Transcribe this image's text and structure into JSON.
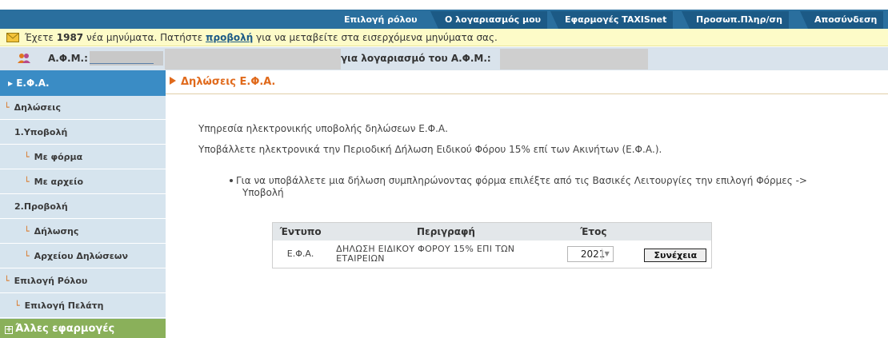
{
  "topnav": {
    "tabs": [
      {
        "label": "Επιλογή ρόλου"
      },
      {
        "label": "Ο λογαριασμός μου"
      },
      {
        "label": "Εφαρμογές TAXISnet"
      },
      {
        "label": "Προσωπ.Πληρ/ση"
      },
      {
        "label": "Αποσύνδεση"
      }
    ]
  },
  "messages": {
    "prefix": "Έχετε",
    "count": "1987",
    "middle": "νέα μηνύματα. Πατήστε",
    "link": "προβολή",
    "suffix": "για να μεταβείτε στα εισερχόμενα μηνύματα σας."
  },
  "afm": {
    "label": "Α.Φ.Μ.:",
    "for_account": "για λογαριασμό του Α.Φ.Μ.:"
  },
  "sidebar": {
    "head": "Ε.Φ.Α.",
    "items": [
      {
        "label": "Δηλώσεις",
        "marker": "└"
      },
      {
        "label": "1.Υποβολή",
        "marker": ""
      },
      {
        "label": "Με φόρμα",
        "marker": "└"
      },
      {
        "label": "Με αρχείο",
        "marker": "└"
      },
      {
        "label": "2.Προβολή",
        "marker": ""
      },
      {
        "label": "Δήλωσης",
        "marker": "└"
      },
      {
        "label": "Αρχείου Δηλώσεων",
        "marker": "└"
      },
      {
        "label": "Επιλογή Ρόλου",
        "marker": "└"
      },
      {
        "label": "Επιλογή Πελάτη",
        "marker": "└"
      }
    ],
    "other_apps": "Άλλες εφαρμογές"
  },
  "main": {
    "title": "Δηλώσεις Ε.Φ.Α.",
    "intro": "Υπηρεσία ηλεκτρονικής υποβολής δηλώσεων Ε.Φ.Α.",
    "description": "Υποβάλλετε ηλεκτρονικά την Περιοδική Δήλωση Ειδικού Φόρου 15% επί των Ακινήτων (Ε.Φ.Α.).",
    "bullet_line1": "Για να υποβάλλετε μια δήλωση συμπληρώνοντας φόρμα επιλέξτε από τις Βασικές Λειτουργίες την επιλογή Φόρμες ->",
    "bullet_line2": "Υποβολή"
  },
  "table": {
    "headers": {
      "form": "Έντυπο",
      "description": "Περιγραφή",
      "year": "Έτος"
    },
    "row": {
      "form": "Ε.Φ.Α.",
      "description_line1": "ΔΗΛΩΣΗ ΕΙΔΙΚΟΥ ΦΟΡΟΥ 15% ΕΠΙ ΤΩΝ",
      "description_line2": "ΕΤΑΙΡΕΙΩΝ",
      "year": "2021",
      "continue_label": "Συνέχεια"
    }
  },
  "colors": {
    "nav": "#1c5a86",
    "accent_orange": "#e06a1c",
    "sidebar_head": "#3a8cc5",
    "sidebar_bg": "#d6e4ee",
    "other_apps": "#8ab05a",
    "message_bar": "#fdfbc8"
  }
}
